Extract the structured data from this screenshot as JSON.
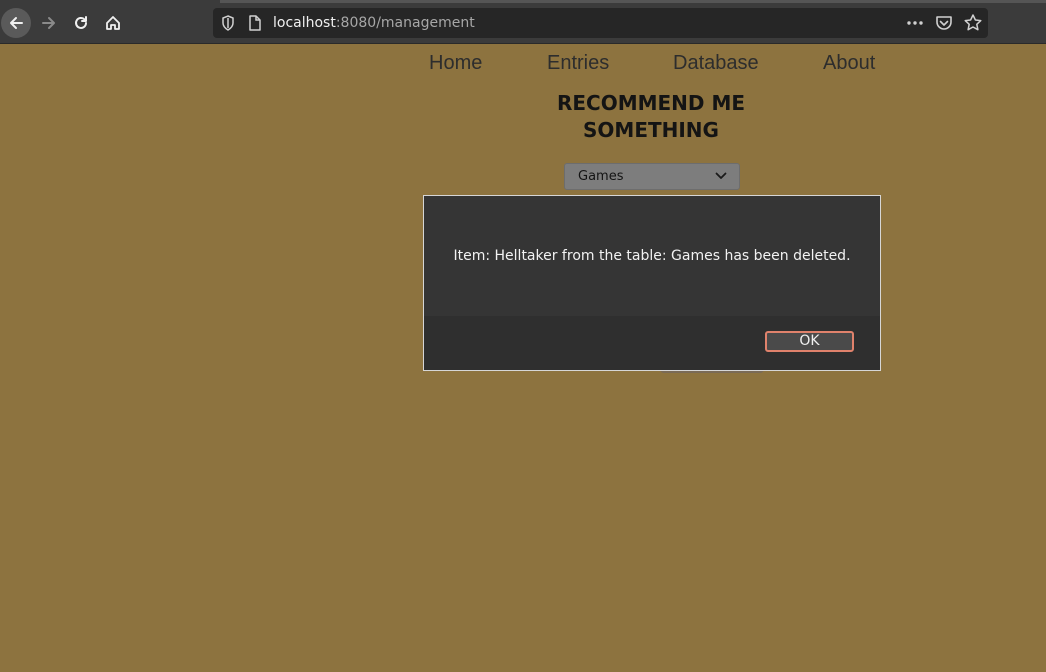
{
  "browser": {
    "url_host": "localhost",
    "url_rest": ":8080/management"
  },
  "nav": {
    "home": "Home",
    "entries": "Entries",
    "database": "Database",
    "about": "About"
  },
  "page": {
    "title_line1": "RECOMMEND ME",
    "title_line2": "SOMETHING",
    "category_select_value": "Games"
  },
  "dialog": {
    "message": "Item: Helltaker from the table: Games has been deleted.",
    "ok_label": "OK"
  },
  "colors": {
    "page_background": "#8d733f",
    "dialog_background": "#353535",
    "ok_button_focus_border": "#e0826c"
  }
}
